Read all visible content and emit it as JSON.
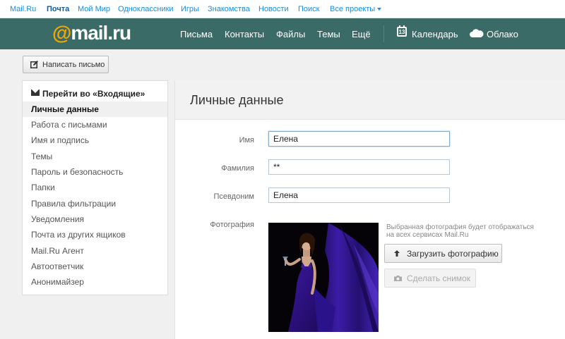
{
  "portal": {
    "links": [
      "Mail.Ru",
      "Почта",
      "Мой Мир",
      "Одноклассники",
      "Игры",
      "Знакомства",
      "Новости",
      "Поиск",
      "Все проекты"
    ]
  },
  "header": {
    "logo_at": "@",
    "logo_text": "mail.ru",
    "nav": [
      "Письма",
      "Контакты",
      "Файлы",
      "Темы",
      "Ещё"
    ],
    "calendar_label": "Календарь",
    "calendar_day": "13",
    "cloud_label": "Облако"
  },
  "toolbar": {
    "compose_label": "Написать письмо"
  },
  "sidebar": {
    "inbox_label": "Перейти во «Входящие»",
    "items": [
      "Личные данные",
      "Работа с письмами",
      "Имя и подпись",
      "Темы",
      "Пароль и безопасность",
      "Папки",
      "Правила фильтрации",
      "Уведомления",
      "Почта из других ящиков",
      "Mail.Ru Агент",
      "Автоответчик",
      "Анонимайзер"
    ],
    "active_index": 0
  },
  "main": {
    "title": "Личные данные",
    "fields": {
      "name_label": "Имя",
      "name_value": "Елена",
      "surname_label": "Фамилия",
      "surname_value": "**",
      "nickname_label": "Псевдоним",
      "nickname_value": "Елена",
      "photo_label": "Фотография"
    },
    "photo_hint": "Выбранная фотография будет отображаться на всех сервисах Mail.Ru",
    "upload_label": "Загрузить фотографию",
    "snapshot_label": "Сделать снимок"
  },
  "colors": {
    "header_bg": "#3a6b67",
    "link": "#168de2",
    "logo_accent": "#f7a600"
  }
}
